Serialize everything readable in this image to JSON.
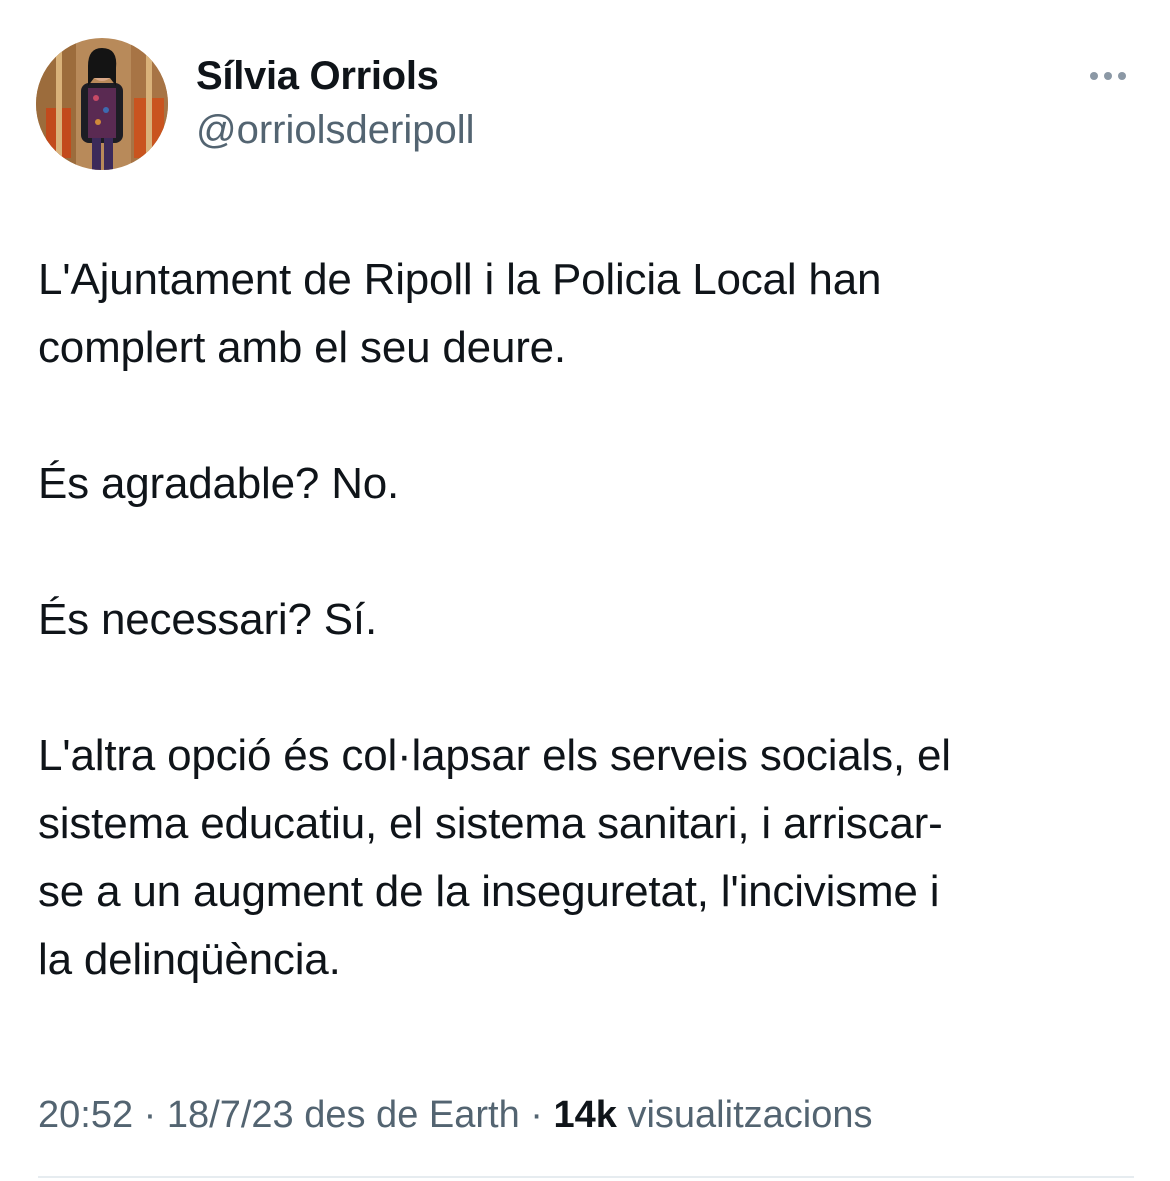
{
  "author": {
    "display_name": "Sílvia Orriols",
    "handle": "@orriolsderipoll",
    "avatar_icon": "profile-photo"
  },
  "more_icon": "more-dots-icon",
  "tweet": {
    "paragraphs": [
      "L'Ajuntament de Ripoll i la Policia Local han\ncomplert amb el seu deure.",
      "És agradable? No.",
      "És necessari? Sí.",
      "L'altra opció és col·lapsar els serveis socials, el\nsistema educatiu, el sistema sanitari, i arriscar-\nse a un augment de la inseguretat, l'incivisme i\nla delinqüència."
    ]
  },
  "meta": {
    "time": "20:52",
    "date": "18/7/23",
    "source": "des de Earth",
    "views_count": "14k",
    "views_label": "visualitzacions",
    "separator": "·"
  },
  "colors": {
    "text": "#0f1419",
    "secondary": "#536471",
    "divider": "#e6ecf0"
  }
}
